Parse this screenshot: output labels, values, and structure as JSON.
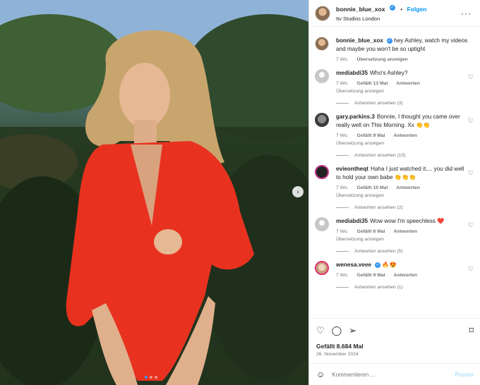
{
  "post": {
    "username": "bonnie_blue_xox",
    "verified_glyph": "✓",
    "separator": "•",
    "follow_label": "Folgen",
    "location": "Itv Studios London",
    "more_glyph": "···",
    "next_glyph": "›"
  },
  "caption": {
    "username": "bonnie_blue_xox",
    "text": "hey Ashley, watch my videos and maybe you won't be so uptight",
    "time": "7 Wo.",
    "translate": "Übersetzung anzeigen"
  },
  "comments": [
    {
      "username": "mediabdi35",
      "text": "Who's Ashley?",
      "time": "7 Wo.",
      "likes": "Gefällt 13 Mal",
      "reply": "Antworten",
      "translate": "Übersetzung anzeigen",
      "replies": "Antworten ansehen (3)"
    },
    {
      "username": "gary.parkins.3",
      "text": "Bonnie, I thought you came over really well on This Morning. Xx 👏👏",
      "time": "7 Wo.",
      "likes": "Gefällt 9 Mal",
      "reply": "Antworten",
      "translate": "Übersetzung anzeigen",
      "replies": "Antworten ansehen (10)"
    },
    {
      "username": "evieontheqt",
      "text": "Haha I just watched it.... you did well to hold your own babe 👏👏👏",
      "time": "7 Wo.",
      "likes": "Gefällt 10 Mal",
      "reply": "Antworten",
      "translate": "Übersetzung anzeigen",
      "replies": "Antworten ansehen (2)"
    },
    {
      "username": "mediabdi35",
      "text": "Wow wow I'm speechless ❤️",
      "time": "7 Wo.",
      "likes": "Gefällt 6 Mal",
      "reply": "Antworten",
      "translate": "Übersetzung anzeigen",
      "replies": "Antworten ansehen (5)"
    },
    {
      "username": "wenesa.veee",
      "text": "🔥😍",
      "time": "7 Wo.",
      "likes": "Gefällt 9 Mal",
      "reply": "Antworten",
      "translate": "",
      "replies": "Antworten ansehen (1)"
    }
  ],
  "actions": {
    "like_icon": "♡",
    "comment_icon": "◯",
    "share_icon": "➢",
    "bookmark_icon": "⌑",
    "likes_count": "Gefällt 8.684 Mal",
    "date": "26. November 2024"
  },
  "comment_box": {
    "emoji_icon": "☺",
    "placeholder": "Kommentieren ...",
    "post_label": "Posten"
  },
  "colors": {
    "accent": "#0095f6",
    "swimsuit": "#e8321f"
  }
}
